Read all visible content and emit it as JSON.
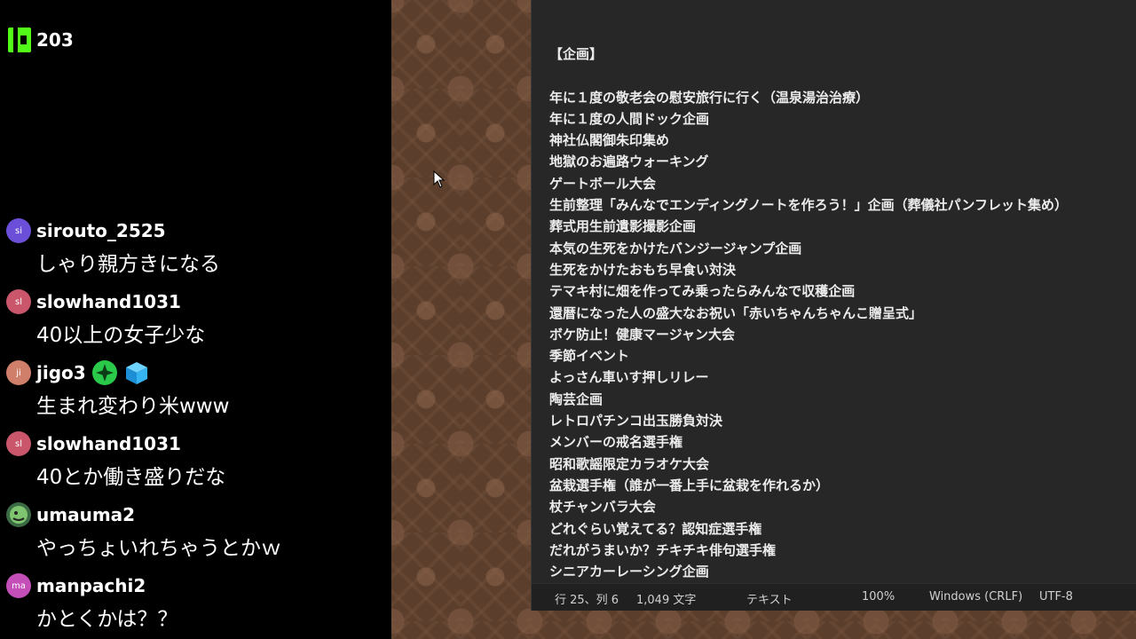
{
  "chat": {
    "viewer_count": "203",
    "messages": [
      {
        "user": "sirouto_2525",
        "avatar": "si",
        "color": "#6c4fd8",
        "text": "しゃり親方きになる"
      },
      {
        "user": "slowhand1031",
        "avatar": "sl",
        "color": "#c9566b",
        "text": "40以上の女子少な"
      },
      {
        "user": "jigo3",
        "avatar": "ji",
        "color": "#d0806a",
        "text": "生まれ変わり米www"
      },
      {
        "user": "slowhand1031",
        "avatar": "sl",
        "color": "#c9566b",
        "text": "40とか働き盛りだな"
      },
      {
        "user": "umauma2",
        "avatar": "",
        "color": "#3b6b45",
        "text": "やっちょいれちゃうとかｗ"
      },
      {
        "user": "manpachi2",
        "avatar": "ma",
        "color": "#c44fb8",
        "text": "かとくかは？？"
      }
    ]
  },
  "notepad": {
    "heading": "【企画】",
    "lines": [
      "年に１度の敬老会の慰安旅行に行く（温泉湯治治療）",
      "年に１度の人間ドック企画",
      "神社仏閣御朱印集め",
      "地獄のお遍路ウォーキング",
      "ゲートボール大会",
      "生前整理「みんなでエンディングノートを作ろう！」企画（葬儀社パンフレット集め）",
      "葬式用生前遺影撮影企画",
      "本気の生死をかけたバンジージャンプ企画",
      "生死をかけたおもち早食い対決",
      "テマキ村に畑を作ってみ乗ったらみんなで収穫企画",
      "還暦になった人の盛大なお祝い「赤いちゃんちゃんこ贈呈式」",
      "ボケ防止！健康マージャン大会",
      "季節イベント",
      "よっさん車いす押しリレー",
      "陶芸企画",
      "レトロパチンコ出玉勝負対決",
      "メンバーの戒名選手権",
      "昭和歌謡限定カラオケ大会",
      "盆栽選手権（誰が一番上手に盆栽を作れるか）",
      "杖チャンバラ大会",
      "どれぐらい覚えてる？認知症選手権",
      "だれがうまいか？チキチキ俳句選手権",
      "シニアカーレーシング企画"
    ],
    "status": {
      "position": "行 25、列 6",
      "chars": "1,049 文字",
      "format": "テキスト",
      "zoom": "100%",
      "eol": "Windows (CRLF)",
      "encoding": "UTF-8"
    }
  },
  "icons": {
    "brand": "kick-logo-icon",
    "badge1": "star-badge-icon",
    "badge2": "cube-badge-icon",
    "pointer": "mouse-cursor-icon"
  }
}
